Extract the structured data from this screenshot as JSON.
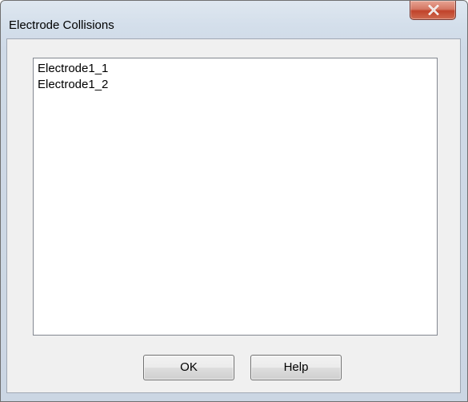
{
  "window": {
    "title": "Electrode Collisions"
  },
  "titlebar": {
    "close_icon": "close-x-icon"
  },
  "list": {
    "items": [
      {
        "label": "Electrode1_1"
      },
      {
        "label": "Electrode1_2"
      }
    ]
  },
  "buttons": {
    "ok_label": "OK",
    "help_label": "Help"
  },
  "colors": {
    "close_button": "#c7503a",
    "frame": "#cfdae7",
    "client": "#f0f0f0"
  }
}
